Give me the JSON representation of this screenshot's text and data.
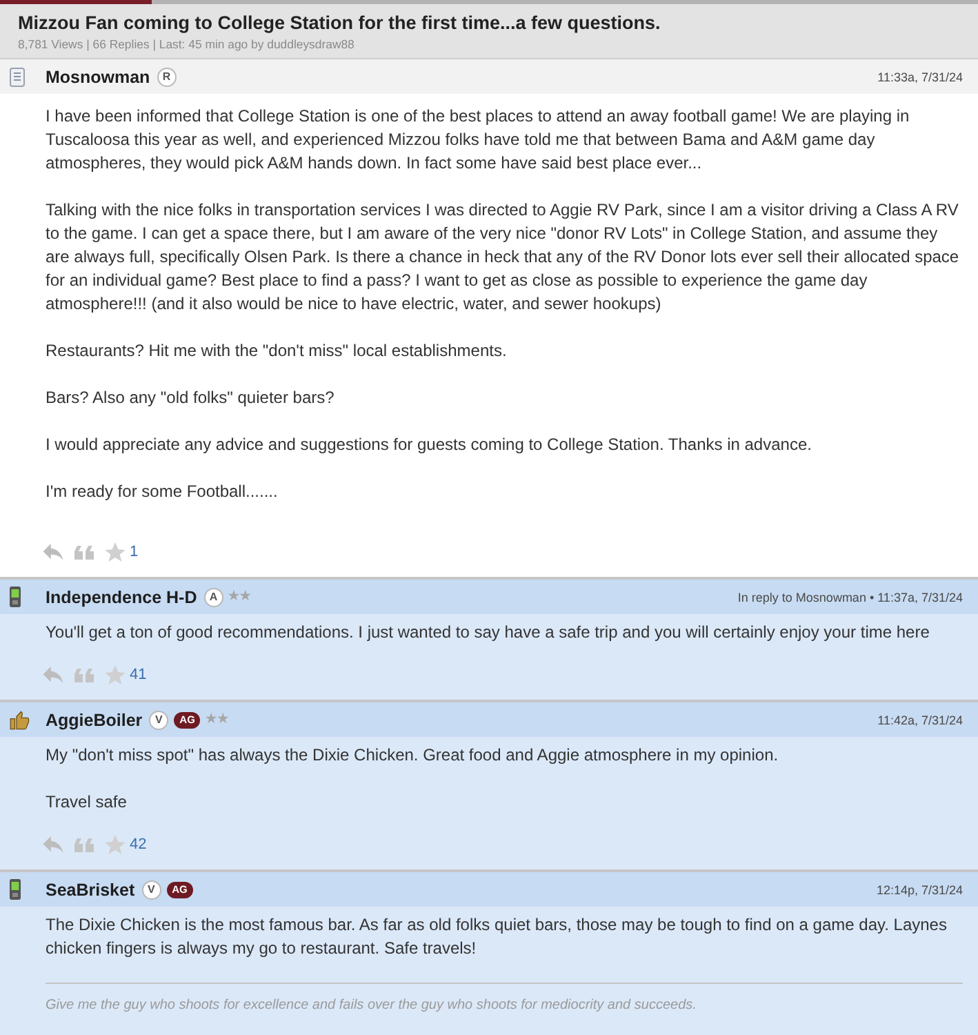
{
  "progress_bar": {
    "level": 0.155
  },
  "thread": {
    "title": "Mizzou Fan coming to College Station for the first time...a few questions.",
    "stats": "8,781 Views | 66 Replies | Last: 45 min ago by duddleysdraw88"
  },
  "posts": [
    {
      "kind": "document",
      "author": "Mosnowman",
      "badges": [
        {
          "kind": "circle",
          "text": "R"
        }
      ],
      "posted": "11:33a, 7/31/24",
      "highlighted": false,
      "body": [
        "I have been informed that College Station is one of the best places to attend an away football game! We are playing in Tuscaloosa this year as well, and experienced Mizzou folks have told me that between Bama and A&M game day atmospheres, they would pick A&M hands down. In fact some have said best place ever...",
        "Talking with the nice folks in transportation services I was directed to Aggie RV Park, since I am a visitor driving a Class A RV to the game. I can get a space there, but I am aware of the very nice \"donor RV Lots\" in College Station, and assume they are always full, specifically Olsen Park. Is there a chance in heck that any of the RV Donor lots ever sell their allocated space for an individual game? Best place to find a pass? I want to get as close as possible to experience the game day atmosphere!!! (and it also would be nice to have electric, water, and sewer hookups)",
        "Restaurants? Hit me with the \"don't miss\" local establishments.",
        "Bars? Also any \"old folks\" quieter bars?",
        "I would appreciate any advice and suggestions for guests coming to College Station. Thanks in advance.",
        "I'm ready for some Football......."
      ],
      "likes": "1"
    },
    {
      "kind": "phone",
      "author": "Independence H-D",
      "badges": [
        {
          "kind": "circle",
          "text": "A"
        }
      ],
      "rank": "★★",
      "posted": "In reply to Mosnowman • 11:37a, 7/31/24",
      "highlighted": true,
      "body": [
        "You'll get a ton of good recommendations. I just wanted to say have a safe trip and you will certainly enjoy your time here"
      ],
      "likes": "41"
    },
    {
      "kind": "thumbs-up",
      "author": "AggieBoiler",
      "badges": [
        {
          "kind": "circle",
          "text": "V"
        },
        {
          "kind": "pill",
          "text": "AG"
        }
      ],
      "rank": "★★",
      "posted": "11:42a, 7/31/24",
      "highlighted": true,
      "body": [
        "My \"don't miss spot\" has always the Dixie Chicken. Great food and Aggie atmosphere in my opinion.",
        "Travel safe"
      ],
      "likes": "42"
    },
    {
      "kind": "phone",
      "author": "SeaBrisket",
      "badges": [
        {
          "kind": "circle",
          "text": "V"
        },
        {
          "kind": "pill",
          "text": "AG"
        }
      ],
      "posted": "12:14p, 7/31/24",
      "highlighted": true,
      "body": [
        "The Dixie Chicken is the most famous bar. As far as old folks quiet bars, those may be tough to find on a game day. Laynes chicken fingers is always my go to restaurant. Safe travels!"
      ],
      "signature": "Give me the guy who shoots for excellence and fails over the guy who shoots for mediocrity and succeeds."
    }
  ]
}
